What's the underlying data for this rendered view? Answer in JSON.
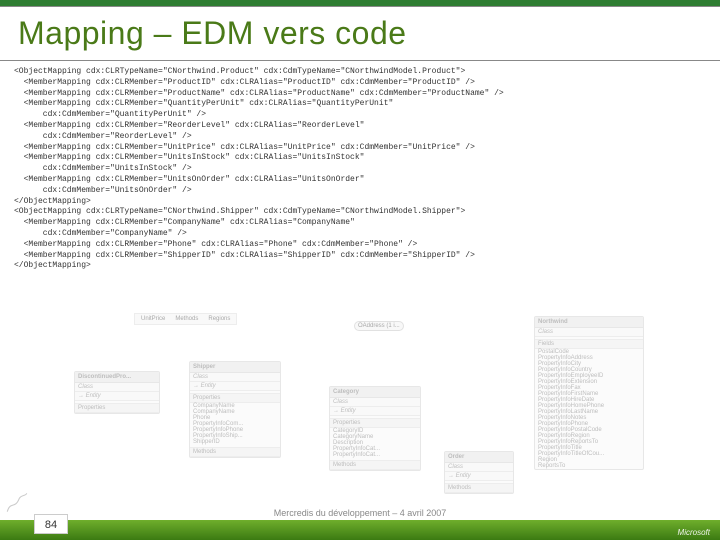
{
  "title": "Mapping – EDM vers code",
  "xml_lines": [
    "<ObjectMapping cdx:CLRTypeName=\"CNorthwind.Product\" cdx:CdmTypeName=\"CNorthwindModel.Product\">",
    "  <MemberMapping cdx:CLRMember=\"ProductID\" cdx:CLRAlias=\"ProductID\" cdx:CdmMember=\"ProductID\" />",
    "  <MemberMapping cdx:CLRMember=\"ProductName\" cdx:CLRAlias=\"ProductName\" cdx:CdmMember=\"ProductName\" />",
    "  <MemberMapping cdx:CLRMember=\"QuantityPerUnit\" cdx:CLRAlias=\"QuantityPerUnit\"",
    "      cdx:CdmMember=\"QuantityPerUnit\" />",
    "  <MemberMapping cdx:CLRMember=\"ReorderLevel\" cdx:CLRAlias=\"ReorderLevel\"",
    "      cdx:CdmMember=\"ReorderLevel\" />",
    "  <MemberMapping cdx:CLRMember=\"UnitPrice\" cdx:CLRAlias=\"UnitPrice\" cdx:CdmMember=\"UnitPrice\" />",
    "  <MemberMapping cdx:CLRMember=\"UnitsInStock\" cdx:CLRAlias=\"UnitsInStock\"",
    "      cdx:CdmMember=\"UnitsInStock\" />",
    "  <MemberMapping cdx:CLRMember=\"UnitsOnOrder\" cdx:CLRAlias=\"UnitsOnOrder\"",
    "      cdx:CdmMember=\"UnitsOnOrder\" />",
    "</ObjectMapping>",
    "<ObjectMapping cdx:CLRTypeName=\"CNorthwind.Shipper\" cdx:CdmTypeName=\"CNorthwindModel.Shipper\">",
    "  <MemberMapping cdx:CLRMember=\"CompanyName\" cdx:CLRAlias=\"CompanyName\"",
    "      cdx:CdmMember=\"CompanyName\" />",
    "  <MemberMapping cdx:CLRMember=\"Phone\" cdx:CLRAlias=\"Phone\" cdx:CdmMember=\"Phone\" />",
    "  <MemberMapping cdx:CLRMember=\"ShipperID\" cdx:CLRAlias=\"ShipperID\" cdx:CdmMember=\"ShipperID\" />",
    "</ObjectMapping>"
  ],
  "toolbox": {
    "items": [
      "UnitPrice",
      "Methods",
      "Regions"
    ],
    "btn": "OAddress (1 i..."
  },
  "boxes": {
    "discontinued": {
      "title": "DiscontinuedPro...",
      "kind": "Class",
      "arrow": "→ Entity",
      "sect": "Properties"
    },
    "shipper": {
      "title": "Shipper",
      "kind": "Class",
      "arrow": "→ Entity",
      "sect1": "Properties",
      "props": [
        "CompanyName",
        "CompanyName",
        "Phone",
        "PropertyInfoCom...",
        "PropertyInfoPhone",
        "PropertyInfoShip...",
        "ShipperID"
      ],
      "sect2": "Methods"
    },
    "category": {
      "title": "Category",
      "kind": "Class",
      "arrow": "→ Entity",
      "sect1": "Properties",
      "props": [
        "CategoryID",
        "CategoryName",
        "Description",
        "PropertyInfoCat...",
        "PropertyInfoCat..."
      ],
      "sect2": "Methods"
    },
    "northwind": {
      "title": "Northwind",
      "kind": "Class",
      "sect1": "Fields",
      "fields": [
        "PostalCode",
        "PropertyInfoAddress",
        "PropertyInfoCity",
        "PropertyInfoCountry",
        "PropertyInfoEmployeeID",
        "PropertyInfoExtension",
        "PropertyInfoFax",
        "PropertyInfoFirstName",
        "PropertyInfoHireDate",
        "PropertyInfoHomePhone",
        "PropertyInfoLastName",
        "PropertyInfoNotes",
        "PropertyInfoPhone",
        "PropertyInfoPostalCode",
        "PropertyInfoRegion",
        "PropertyInfoReportsTo",
        "PropertyInfoTitle",
        "PropertyInfoTitleOfCou...",
        "Region",
        "ReportsTo"
      ]
    },
    "order": {
      "title": "Order",
      "kind": "Class",
      "arrow": "→ Entity",
      "sect": "Methods"
    }
  },
  "footer": {
    "page": "84",
    "text": "Mercredis du développement – 4 avril 2007",
    "brand": "Microsoft"
  }
}
